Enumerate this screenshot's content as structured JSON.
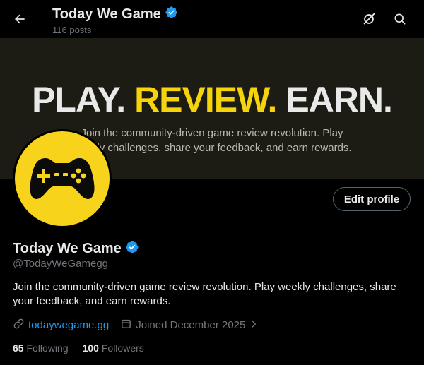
{
  "header": {
    "title": "Today We Game",
    "posts": "116 posts"
  },
  "banner": {
    "headline_part1": "PLAY. ",
    "headline_part2": "REVIEW.",
    "headline_part3": " EARN.",
    "subtext": "Join the community-driven game review revolution. Play weekly challenges, share your feedback, and earn rewards."
  },
  "profile": {
    "name": "Today We Game",
    "handle": "@TodayWeGamegg",
    "bio": "Join the community-driven game review revolution. Play weekly challenges, share your feedback, and earn rewards.",
    "website": "todaywegame.gg",
    "joined": "Joined December 2025",
    "following_count": "65",
    "following_label": "Following",
    "followers_count": "100",
    "followers_label": "Followers",
    "edit_label": "Edit profile",
    "verified": true
  },
  "icons": {
    "back": "arrow-left-icon",
    "grok": "grok-icon",
    "search": "search-icon",
    "verified": "verified-badge-icon",
    "avatar": "gamepad-icon",
    "link": "link-icon",
    "calendar": "calendar-icon",
    "chevron": "chevron-right-icon"
  },
  "colors": {
    "accent": "#1d9bf0",
    "banner_yellow": "#f6d40c",
    "avatar_yellow": "#f7d31c",
    "background": "#000000"
  }
}
